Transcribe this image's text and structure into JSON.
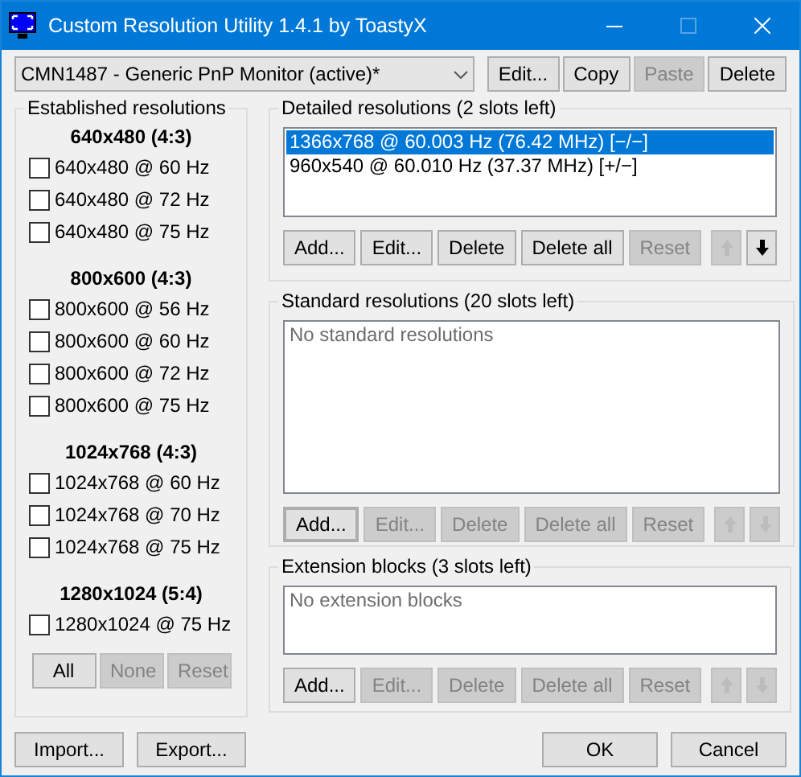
{
  "window": {
    "title": "Custom Resolution Utility 1.4.1 by ToastyX",
    "maximize_disabled": true
  },
  "monitor": {
    "value": "CMN1487 - Generic PnP Monitor (active)*",
    "buttons": [
      {
        "label": "Edit...",
        "disabled": false
      },
      {
        "label": "Copy",
        "disabled": false
      },
      {
        "label": "Paste",
        "disabled": true
      },
      {
        "label": "Delete",
        "disabled": false
      }
    ]
  },
  "established": {
    "title": "Established resolutions",
    "groups": [
      {
        "heading": "640x480 (4:3)",
        "items": [
          {
            "label": "640x480 @ 60 Hz",
            "checked": false
          },
          {
            "label": "640x480 @ 72 Hz",
            "checked": false
          },
          {
            "label": "640x480 @ 75 Hz",
            "checked": false
          }
        ]
      },
      {
        "heading": "800x600 (4:3)",
        "items": [
          {
            "label": "800x600 @ 56 Hz",
            "checked": false
          },
          {
            "label": "800x600 @ 60 Hz",
            "checked": false
          },
          {
            "label": "800x600 @ 72 Hz",
            "checked": false
          },
          {
            "label": "800x600 @ 75 Hz",
            "checked": false
          }
        ]
      },
      {
        "heading": "1024x768 (4:3)",
        "items": [
          {
            "label": "1024x768 @ 60 Hz",
            "checked": false
          },
          {
            "label": "1024x768 @ 70 Hz",
            "checked": false
          },
          {
            "label": "1024x768 @ 75 Hz",
            "checked": false
          }
        ]
      },
      {
        "heading": "1280x1024 (5:4)",
        "items": [
          {
            "label": "1280x1024 @ 75 Hz",
            "checked": false
          }
        ]
      }
    ],
    "buttons": [
      {
        "label": "All",
        "disabled": false
      },
      {
        "label": "None",
        "disabled": true
      },
      {
        "label": "Reset",
        "disabled": true
      }
    ]
  },
  "sections": [
    {
      "title": "Detailed resolutions (2 slots left)",
      "items": [
        {
          "label": "1366x768 @ 60.003 Hz (76.42 MHz) [−/−]",
          "selected": true
        },
        {
          "label": "960x540 @ 60.010 Hz (37.37 MHz) [+/−]",
          "selected": false
        }
      ],
      "buttons": [
        {
          "label": "Add...",
          "disabled": false,
          "focused": false
        },
        {
          "label": "Edit...",
          "disabled": false,
          "focused": false
        },
        {
          "label": "Delete",
          "disabled": false,
          "focused": false
        },
        {
          "label": "Delete all",
          "disabled": false,
          "focused": false
        },
        {
          "label": "Reset",
          "disabled": true,
          "focused": false
        }
      ],
      "move_up": {
        "disabled": true
      },
      "move_down": {
        "disabled": false
      }
    },
    {
      "title": "Standard resolutions (20 slots left)",
      "empty_text": "No standard resolutions",
      "buttons": [
        {
          "label": "Add...",
          "disabled": false,
          "focused": true
        },
        {
          "label": "Edit...",
          "disabled": true,
          "focused": false
        },
        {
          "label": "Delete",
          "disabled": true,
          "focused": false
        },
        {
          "label": "Delete all",
          "disabled": true,
          "focused": false
        },
        {
          "label": "Reset",
          "disabled": true,
          "focused": false
        }
      ],
      "move_up": {
        "disabled": true
      },
      "move_down": {
        "disabled": true
      }
    },
    {
      "title": "Extension blocks (3 slots left)",
      "empty_text": "No extension blocks",
      "buttons": [
        {
          "label": "Add...",
          "disabled": false,
          "focused": false
        },
        {
          "label": "Edit...",
          "disabled": true,
          "focused": false
        },
        {
          "label": "Delete",
          "disabled": true,
          "focused": false
        },
        {
          "label": "Delete all",
          "disabled": true,
          "focused": false
        },
        {
          "label": "Reset",
          "disabled": true,
          "focused": false
        }
      ],
      "move_up": {
        "disabled": true
      },
      "move_down": {
        "disabled": true
      }
    }
  ],
  "footer": {
    "left": [
      {
        "label": "Import..."
      },
      {
        "label": "Export..."
      }
    ],
    "right": [
      {
        "label": "OK"
      },
      {
        "label": "Cancel"
      }
    ]
  }
}
